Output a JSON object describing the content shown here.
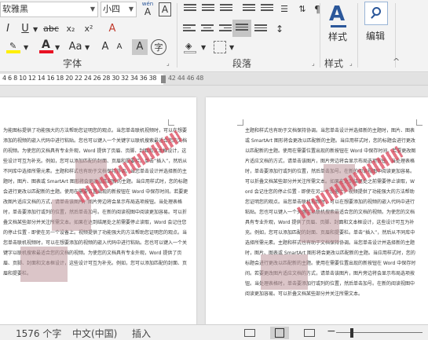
{
  "ribbon": {
    "font_name": "软雅黑",
    "font_size": "小四",
    "phonetic_label": "wén",
    "phonetic_char": "A",
    "char_border": "A",
    "bold": "I",
    "underline": "U",
    "strike": "abc",
    "subscript": "x₂",
    "superscript": "x²",
    "clear_format": "A",
    "font_color": "A",
    "change_case": "Aa",
    "grow": "A",
    "shrink": "A",
    "char_shade": "A",
    "circle_char": "字",
    "styles_label": "样式",
    "editing_label": "编辑",
    "group_font": "字体",
    "group_paragraph": "段落",
    "group_styles": "样式",
    "colors": {
      "accent": "#2b579a",
      "highlight": "#ffef00",
      "font_red": "#e81123"
    }
  },
  "ruler": {
    "active_ticks": "4  6  8 10 12 14 16 18 20 22 24 26 28 30 32 34 36 38",
    "inactive_ticks": "42 44 46 48"
  },
  "doc": {
    "left_page_text": "为能图标提供了功能强大的方法帮助您证明您的观点。当您单击联机视频时，可以在想要添加的视频的嵌入代码中进行粘贴。您也可以键入一个关键字以联机搜索最适合您的文档的视频。为使您的文档具有专业外观，Word 提供了页眉、页脚、封面和文本框设计，这些设计可互为补充。例如，您可以添加匹配的封面、页眉和提要栏。单击“插入”，然后从不同库中选择所需元素。主题和样式也有助于文档保持协调。当您单击设计并选择新的主题时，图片、图表或 SmartArt 图形将会更改以匹配新的主题。当应用样式时，您的标题会进行更改以匹配新的主题。使用在需要位置出现的新按钮在 Word 中保存时间。若要更改图片适应文档的方式，请单击该图片，图片旁边将会显示布局选项按钮。当处理表格时，单击要添加行或列的位置，然后单击加号。在新的阅读视图中阅读更加容易。可以折叠文档某些部分并关注所需文本。如果在达到结尾处之前需要停止读取，Word 会记住您的停止位置 - 即使在另一个设备上。视频提供了功能强大的方法帮助您证明您的观点。当您单击联机视频时，可以在想要添加的视频的嵌入代码中进行粘贴。您也可以键入一个关键字以联机搜索最适合您的文档的视频。为使您的文档具有专业外观，Word 提供了页眉、页脚、封面和文本框设计，这些设计可互为补充。例如，您可以添加匹配的封面、页眉和提要栏。",
    "right_page_text": "主题和样式也有助于文档保持协调。当您单击设计并选择新的主题时，图片、图表或 SmartArt 图形将会更改以匹配新的主题。当应用样式时，您的标题会进行更改以匹配新的主题。使用在需要位置出现的新按钮在 Word 中保存时间。若要更改图片适应文档的方式，请单击该图片，图片旁边将会显示布局选项按钮。当处理表格时，单击要添加行或列的位置，然后单击加号。在新的阅读视图中阅读更加容易。可以折叠文档某些部分并关注所需文本。如果在达到结尾处之前需要停止读取，Word 会记住您的停止位置 - 即使在另一个设备上。视频提供了功能强大的方法帮助您证明您的观点。当您单击联机视频时，可以在想要添加的视频的嵌入代码中进行粘贴。您也可以键入一个关键字以联机搜索最适合您的文档的视频。为使您的文档具有专业外观，Word 提供了页眉、页脚、封面和文本框设计，这些设计可互为补充。例如，您可以添加匹配的封面、页眉和提要栏。单击“插入”，然后从不同库中选择所需元素。主题和样式也有助于文档保持协调。当您单击设计并选择新的主题时，图片、图表或 SmartArt 图形将会更改以匹配新的主题。当应用样式时，您的标题会进行更改以匹配新的主题。使用在需要位置出现的新按钮在 Word 中保存时间。若要更改图片适应文档的方式，请单击该图片，图片旁边将会显示布局选项按钮。当处理表格时，单击要添加行或列的位置，然后单击加号。在新的阅读视图中阅读更加容易。可以折叠文档某些部分并关注所需文本。"
  },
  "status": {
    "word_count": "1576 个字",
    "language": "中文(中国)",
    "mode": "插入"
  }
}
